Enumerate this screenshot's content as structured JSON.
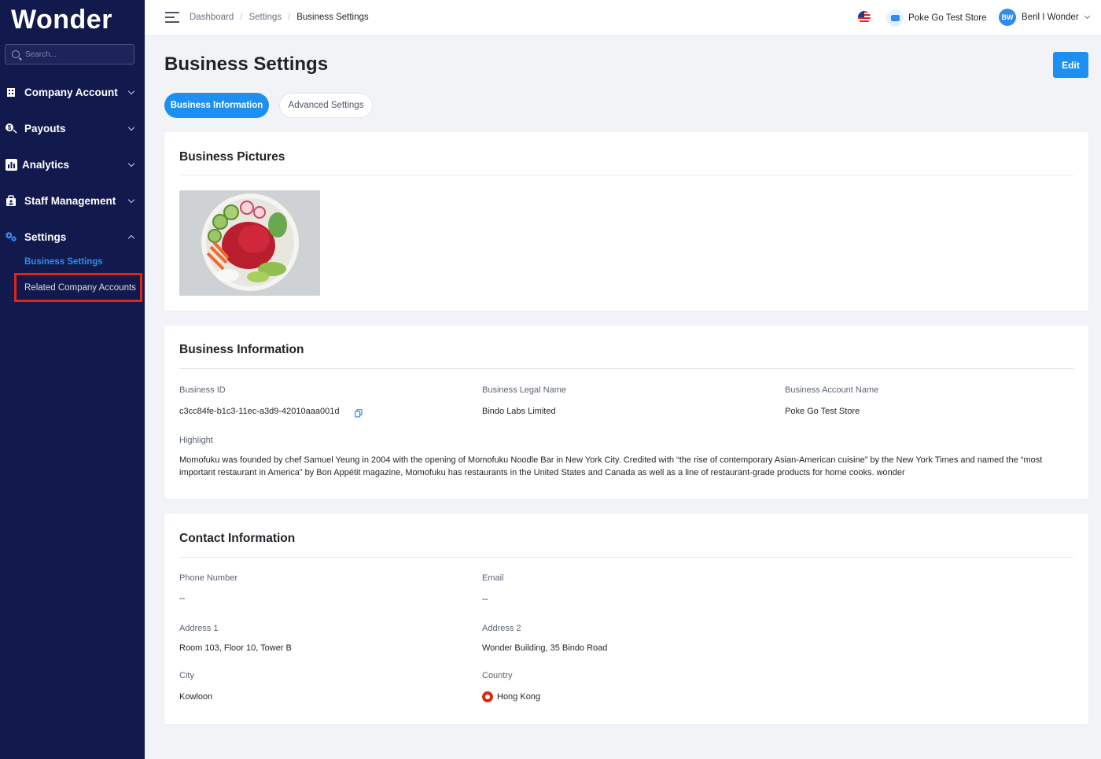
{
  "sidebar": {
    "logo": "Wonder",
    "search_placeholder": "Search...",
    "items": [
      {
        "label": "Company Account"
      },
      {
        "label": "Payouts"
      },
      {
        "label": "Analytics"
      },
      {
        "label": "Staff Management"
      },
      {
        "label": "Settings"
      }
    ],
    "settings_sub": {
      "business_settings": "Business Settings",
      "related_accounts": "Related Company Accounts"
    }
  },
  "topbar": {
    "breadcrumb": [
      "Dashboard",
      "Settings",
      "Business Settings"
    ],
    "store_name": "Poke Go Test Store",
    "user_initials": "BW",
    "user_name": "Beril I Wonder"
  },
  "page": {
    "title": "Business Settings",
    "edit_label": "Edit",
    "tabs": [
      "Business Information",
      "Advanced Settings"
    ]
  },
  "pictures_card": {
    "title": "Business Pictures"
  },
  "business_info": {
    "title": "Business Information",
    "business_id_label": "Business ID",
    "business_id": "c3cc84fe-b1c3-11ec-a3d9-42010aaa001d",
    "legal_name_label": "Business Legal Name",
    "legal_name": "Bindo Labs Limited",
    "account_name_label": "Business Account Name",
    "account_name": "Poke Go Test Store",
    "highlight_label": "Highlight",
    "highlight": "Momofuku was founded by chef Samuel Yeung in 2004 with the opening of Momofuku Noodle Bar in New York City. Credited with “the rise of contemporary Asian-American cuisine” by the New York Times and named the “most important restaurant in America” by Bon Appétit magazine, Momofuku has restaurants in the United States and Canada as well as a line of restaurant-grade products for home cooks. wonder"
  },
  "contact_info": {
    "title": "Contact Information",
    "phone_label": "Phone Number",
    "phone": "--",
    "email_label": "Email",
    "email": "--",
    "address1_label": "Address 1",
    "address1": "Room 103, Floor 10, Tower B",
    "address2_label": "Address 2",
    "address2": "Wonder Building, 35 Bindo Road",
    "city_label": "City",
    "city": "Kowloon",
    "country_label": "Country",
    "country": "Hong Kong"
  },
  "colors": {
    "sidebar_bg": "#121a4d",
    "accent": "#1d8ff0",
    "highlight_box": "#e2231a"
  }
}
